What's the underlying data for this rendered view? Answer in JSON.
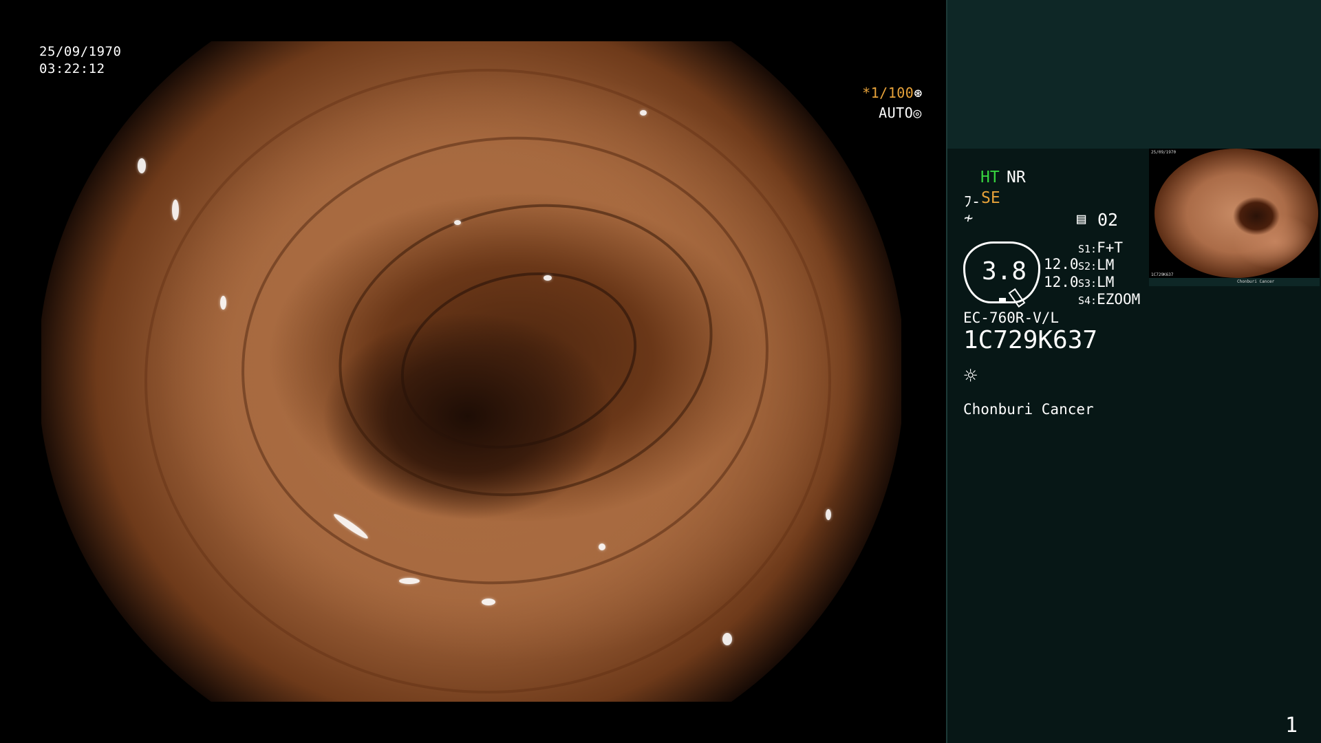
{
  "overlay": {
    "date": "25/09/1970",
    "time": "03:22:12",
    "shutter": "*1/100",
    "shutter_icon": "shutter-icon",
    "mode": "AUTO",
    "mode_icon": "iris-icon"
  },
  "panel": {
    "ht": "HT",
    "nr": "NR",
    "se": "SE",
    "memo_num": "02",
    "dial_value": "3.8",
    "values": [
      "12.0",
      "12.0"
    ],
    "switches": [
      {
        "key": "S1:",
        "value": "F+T"
      },
      {
        "key": "S2:",
        "value": "LM"
      },
      {
        "key": "S3:",
        "value": "LM"
      },
      {
        "key": "S4:",
        "value": "EZOOM"
      }
    ],
    "model": "EC-760R-V/L",
    "serial": "1C729K637",
    "hospital": "Chonburi Cancer",
    "page_num": "1"
  },
  "colors": {
    "ht_green": "#37d43f",
    "accent_orange": "#e8a33a",
    "panel_bg": "#071716",
    "panel_top_bg": "#0e2726"
  }
}
